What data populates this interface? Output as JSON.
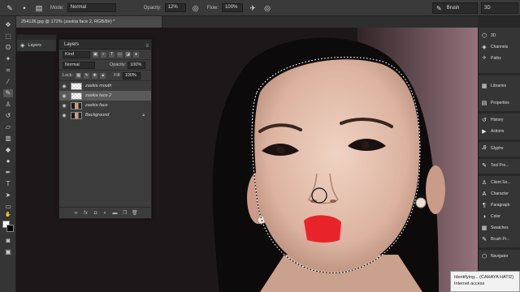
{
  "options_bar": {
    "mode_label": "Mode:",
    "mode_value": "Normal",
    "opacity_label": "Opacity:",
    "opacity_value": "12%",
    "flow_label": "Flow:",
    "flow_value": "100%",
    "workspace_brush": "Brush",
    "workspace_3d": "3D"
  },
  "document": {
    "tab_title": "254126.jpg @ 172% (zaskia face 2, RGB/8#) *"
  },
  "layer_strip": {
    "label": "Layers"
  },
  "layers_panel": {
    "title": "Layers",
    "filter_value": "Kind",
    "blend_mode": "Normal",
    "opacity_label": "Opacity:",
    "opacity_value": "100%",
    "lock_label": "Lock:",
    "fill_label": "Fill:",
    "fill_value": "100%",
    "layers": [
      {
        "name": "zaskia mouth",
        "thumb": "checker",
        "selected": false,
        "locked": false
      },
      {
        "name": "zaskia face 2",
        "thumb": "checker",
        "selected": true,
        "locked": false
      },
      {
        "name": "zaskia face",
        "thumb": "photo",
        "selected": false,
        "locked": false
      },
      {
        "name": "Background",
        "thumb": "photo",
        "selected": false,
        "locked": true
      }
    ],
    "footer_icons": [
      "link-icon",
      "fx-icon",
      "mask-icon",
      "adjustment-icon",
      "group-icon",
      "new-layer-icon",
      "trash-icon"
    ]
  },
  "dock": {
    "group1": [
      {
        "label": "3D",
        "icon": "cube-icon"
      },
      {
        "label": "Channels",
        "icon": "channels-icon"
      },
      {
        "label": "Paths",
        "icon": "paths-icon"
      }
    ],
    "group2": [
      {
        "label": "Libraries",
        "icon": "libraries-icon"
      },
      {
        "label": "Properties",
        "icon": "properties-icon"
      }
    ],
    "group3": [
      {
        "label": "History",
        "icon": "history-icon"
      },
      {
        "label": "Actions",
        "icon": "actions-icon"
      }
    ],
    "group4": [
      {
        "label": "Glyphs",
        "icon": "glyphs-icon"
      }
    ],
    "group5": [
      {
        "label": "Tool Pre...",
        "icon": "tool-presets-icon"
      }
    ],
    "group6": [
      {
        "label": "Client So...",
        "icon": "clone-source-icon"
      },
      {
        "label": "Character",
        "icon": "character-icon"
      },
      {
        "label": "Paragraph",
        "icon": "paragraph-icon"
      },
      {
        "label": "Color",
        "icon": "color-icon"
      },
      {
        "label": "Swatches",
        "icon": "swatches-icon"
      },
      {
        "label": "Brush Pr...",
        "icon": "brush-presets-icon"
      }
    ],
    "group7": [
      {
        "label": "Navigator",
        "icon": "navigator-icon"
      }
    ]
  },
  "notification": {
    "line1": "Identifying... (CAHAYA HATI2)",
    "line2": "Internet access"
  },
  "colors": {
    "lip_red": "#e8242a",
    "selection_marquee": "#ffffff"
  }
}
